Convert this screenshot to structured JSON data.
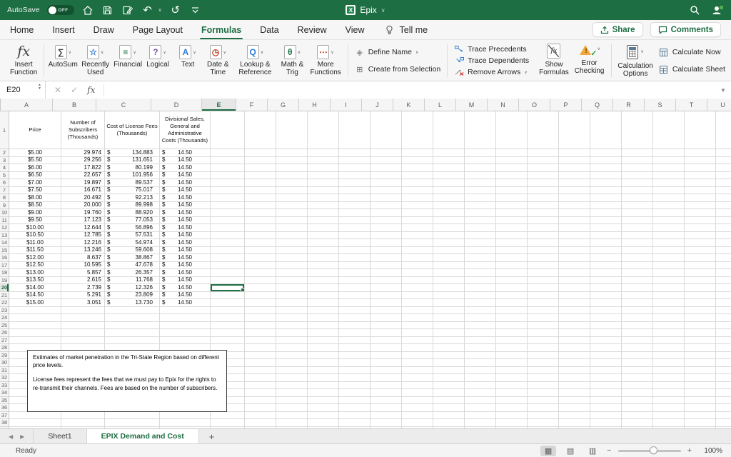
{
  "titlebar": {
    "autosave_label": "AutoSave",
    "autosave_state": "OFF",
    "doc_title": "Epix"
  },
  "ribbon": {
    "active_tab": "Formulas",
    "tabs": [
      "Home",
      "Insert",
      "Draw",
      "Page Layout",
      "Formulas",
      "Data",
      "Review",
      "View"
    ],
    "tell_me": "Tell me",
    "share": "Share",
    "comments": "Comments",
    "insert_function": "Insert\nFunction",
    "function_buttons": [
      {
        "label": "AutoSum",
        "icon": "sigma-icon"
      },
      {
        "label": "Recently Used",
        "icon": "star-icon"
      },
      {
        "label": "Financial",
        "icon": "coins-icon"
      },
      {
        "label": "Logical",
        "icon": "question-icon"
      },
      {
        "label": "Text",
        "icon": "letter-a-icon"
      },
      {
        "label": "Date & Time",
        "icon": "clock-icon"
      },
      {
        "label": "Lookup & Reference",
        "icon": "magnifier-icon"
      },
      {
        "label": "Math & Trig",
        "icon": "theta-icon"
      },
      {
        "label": "More Functions",
        "icon": "ellipsis-icon"
      }
    ],
    "define_name": "Define Name",
    "create_from_selection": "Create from Selection",
    "trace_precedents": "Trace Precedents",
    "trace_dependents": "Trace Dependents",
    "remove_arrows": "Remove Arrows",
    "show_formulas": "Show\nFormulas",
    "error_checking": "Error\nChecking",
    "calculation_options": "Calculation\nOptions",
    "calculate_now": "Calculate Now",
    "calculate_sheet": "Calculate Sheet"
  },
  "formula_bar": {
    "cell_reference": "E20"
  },
  "sheet": {
    "columns": [
      "A",
      "B",
      "C",
      "D",
      "E",
      "F",
      "G",
      "H",
      "I",
      "J",
      "K",
      "L",
      "M",
      "N",
      "O",
      "P",
      "Q",
      "R",
      "S",
      "T",
      "U"
    ],
    "column_headers": {
      "A": "Price",
      "B": "Number of Subscribers (Thousands)",
      "C": "Cost of License Fees (Thousands)",
      "D": "Divisional Sales, General and Administrative Costs (Thousands)"
    },
    "currency_symbol": "$",
    "selection": {
      "cell": "E20",
      "column": "E",
      "row": 20
    },
    "rows": [
      {
        "price": "$5.00",
        "subscribers": "29.974",
        "license_fees": "134.883",
        "admin_costs": "14.50"
      },
      {
        "price": "$5.50",
        "subscribers": "29.256",
        "license_fees": "131.651",
        "admin_costs": "14.50"
      },
      {
        "price": "$6.00",
        "subscribers": "17.822",
        "license_fees": "80.199",
        "admin_costs": "14.50"
      },
      {
        "price": "$6.50",
        "subscribers": "22.657",
        "license_fees": "101.956",
        "admin_costs": "14.50"
      },
      {
        "price": "$7.00",
        "subscribers": "19.897",
        "license_fees": "89.537",
        "admin_costs": "14.50"
      },
      {
        "price": "$7.50",
        "subscribers": "16.671",
        "license_fees": "75.017",
        "admin_costs": "14.50"
      },
      {
        "price": "$8.00",
        "subscribers": "20.492",
        "license_fees": "92.213",
        "admin_costs": "14.50"
      },
      {
        "price": "$8.50",
        "subscribers": "20.000",
        "license_fees": "89.998",
        "admin_costs": "14.50"
      },
      {
        "price": "$9.00",
        "subscribers": "19.760",
        "license_fees": "88.920",
        "admin_costs": "14.50"
      },
      {
        "price": "$9.50",
        "subscribers": "17.123",
        "license_fees": "77.053",
        "admin_costs": "14.50"
      },
      {
        "price": "$10.00",
        "subscribers": "12.644",
        "license_fees": "56.896",
        "admin_costs": "14.50"
      },
      {
        "price": "$10.50",
        "subscribers": "12.785",
        "license_fees": "57.531",
        "admin_costs": "14.50"
      },
      {
        "price": "$11.00",
        "subscribers": "12.216",
        "license_fees": "54.974",
        "admin_costs": "14.50"
      },
      {
        "price": "$11.50",
        "subscribers": "13.246",
        "license_fees": "59.608",
        "admin_costs": "14.50"
      },
      {
        "price": "$12.00",
        "subscribers": "8.637",
        "license_fees": "38.867",
        "admin_costs": "14.50"
      },
      {
        "price": "$12.50",
        "subscribers": "10.595",
        "license_fees": "47.678",
        "admin_costs": "14.50"
      },
      {
        "price": "$13.00",
        "subscribers": "5.857",
        "license_fees": "26.357",
        "admin_costs": "14.50"
      },
      {
        "price": "$13.50",
        "subscribers": "2.615",
        "license_fees": "11.768",
        "admin_costs": "14.50"
      },
      {
        "price": "$14.00",
        "subscribers": "2.739",
        "license_fees": "12.326",
        "admin_costs": "14.50"
      },
      {
        "price": "$14.50",
        "subscribers": "5.291",
        "license_fees": "23.809",
        "admin_costs": "14.50"
      },
      {
        "price": "$15.00",
        "subscribers": "3.051",
        "license_fees": "13.730",
        "admin_costs": "14.50"
      }
    ],
    "note_box": {
      "paragraphs": [
        "Estimates of market penetration in the Tri-State Region based on different price levels.",
        "License fees represent the fees that we must pay to Epix for the rights to re-transmit their channels. Fees are based on the number of subscribers."
      ]
    }
  },
  "sheet_tabs": {
    "tabs": [
      "Sheet1",
      "EPIX Demand and Cost"
    ],
    "active": "EPIX Demand and Cost",
    "add_label": "+"
  },
  "status_bar": {
    "status": "Ready",
    "zoom_level": "100%"
  }
}
